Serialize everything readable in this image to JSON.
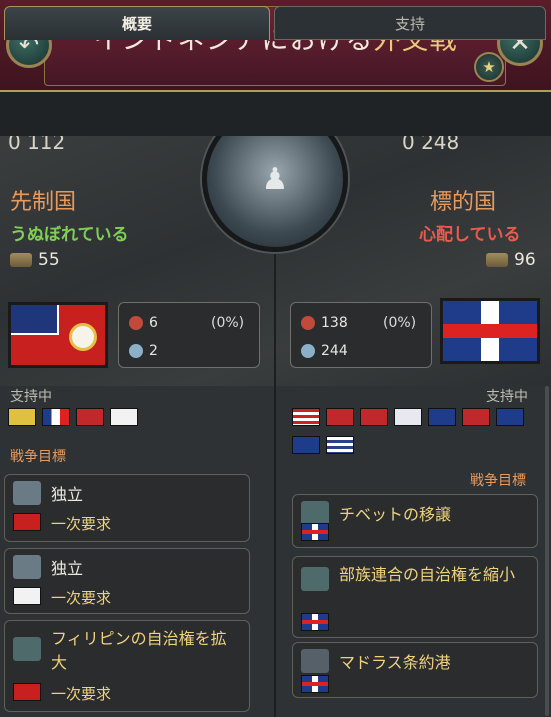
{
  "header": {
    "title_prefix": "インドネシアにおける",
    "title_highlight": "外交戦",
    "back_icon": "back-arrow-icon",
    "close_icon": "close-icon"
  },
  "tabs": [
    {
      "label": "概要"
    },
    {
      "label": "支持"
    }
  ],
  "top_partial": {
    "left": "0 112",
    "right": "0 248"
  },
  "attacker": {
    "title": "先制国",
    "mood": "うぬぼれている",
    "prestige": "55",
    "soldiers": "6",
    "soldiers_pct": "(0%)",
    "defense": "2",
    "supporters_label": "支持中"
  },
  "target": {
    "title": "標的国",
    "mood": "心配している",
    "prestige": "96",
    "soldiers": "138",
    "soldiers_pct": "(0%)",
    "defense": "244",
    "supporters_label": "支持中"
  },
  "wargoals_label": "戦争目標",
  "left_goals": [
    {
      "name": "独立",
      "demand": "一次要求"
    },
    {
      "name": "独立",
      "demand": "一次要求"
    },
    {
      "name": "フィリピンの自治権を拡大",
      "demand": "一次要求"
    }
  ],
  "right_goals": [
    {
      "name": "チベットの移譲"
    },
    {
      "name": "部族連合の自治権を縮小"
    },
    {
      "name": "マドラス条約港"
    }
  ],
  "colors": {
    "accent_orange": "#e89a5c",
    "mood_positive": "#7fcf55",
    "mood_negative": "#ec5a4c",
    "highlight_gold": "#f0d27e"
  }
}
